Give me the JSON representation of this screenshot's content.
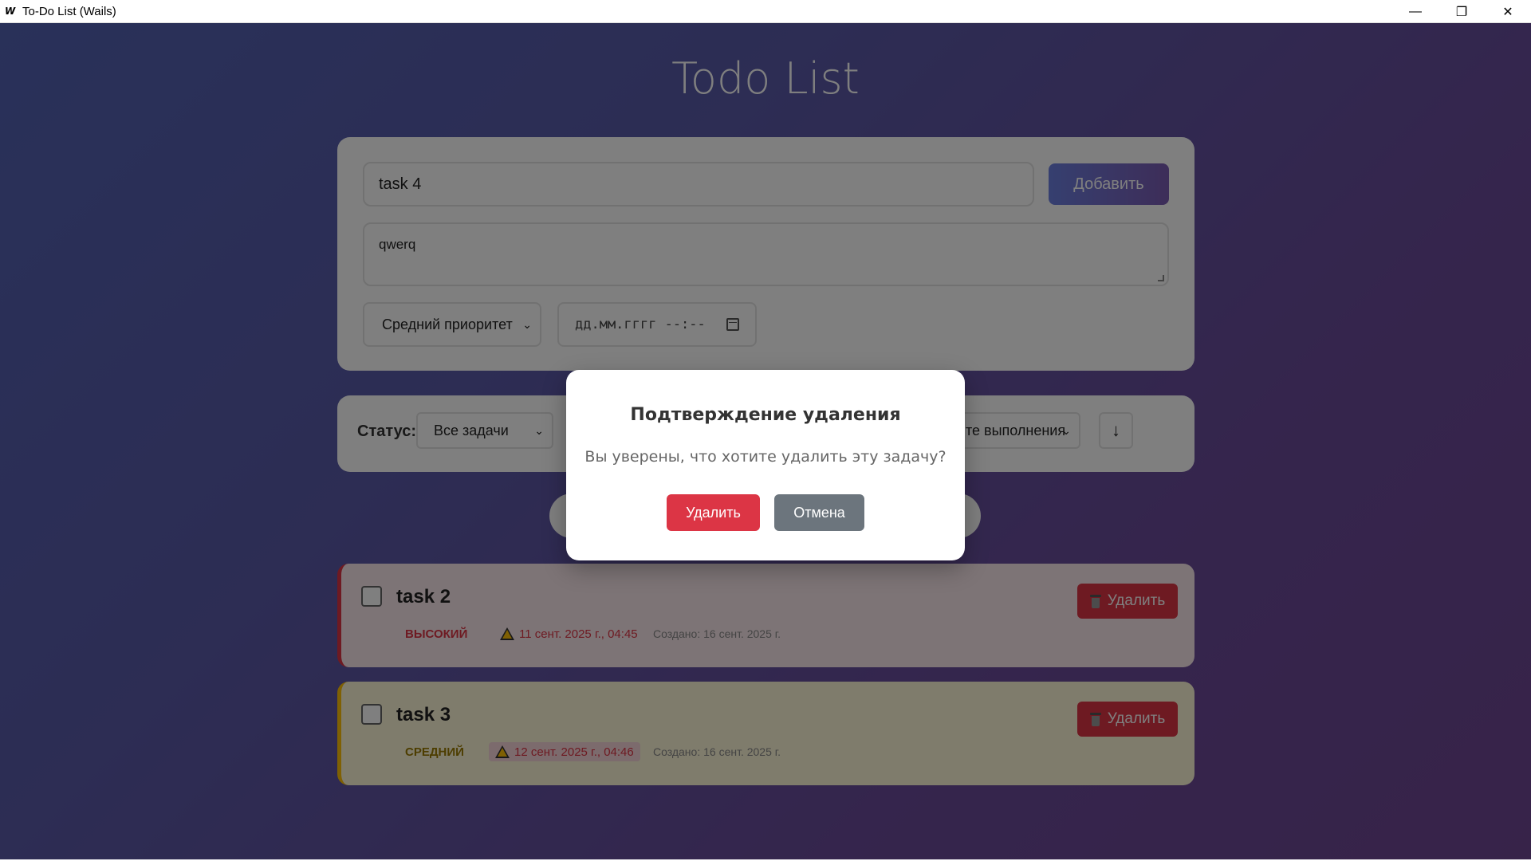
{
  "window": {
    "title": "To-Do List (Wails)",
    "logo_letter": "W",
    "minimize_glyph": "—",
    "maximize_glyph": "❐",
    "close_glyph": "✕"
  },
  "app": {
    "title": "Todo List"
  },
  "form": {
    "title_value": "task 4",
    "add_label": "Добавить",
    "description_value": "qwerq",
    "priority_selected": "Средний приоритет",
    "due_placeholder": "дд.мм.гггг --:--"
  },
  "filters": {
    "status_label": "Статус:",
    "status_selected": "Все задачи",
    "sort_selected_visible": "те выполнения",
    "sort_direction": "↓"
  },
  "tasks": [
    {
      "title": "task 2",
      "priority": "ВЫСОКИЙ",
      "due": "11 сент. 2025 г., 04:45",
      "created": "Создано: 16 сент. 2025 г.",
      "delete_label": "Удалить",
      "accent_color": "#dc3545"
    },
    {
      "title": "task 3",
      "priority": "СРЕДНИЙ",
      "due": "12 сент. 2025 г., 04:46",
      "created": "Создано: 16 сент. 2025 г.",
      "delete_label": "Удалить",
      "accent_color": "#ffc107"
    }
  ],
  "modal": {
    "title": "Подтверждение удаления",
    "message": "Вы уверены, что хотите удалить эту задачу?",
    "confirm_label": "Удалить",
    "cancel_label": "Отмена"
  },
  "icons": {
    "chevron": "⌄",
    "calendar": "calendar-icon",
    "warning": "warning-icon",
    "trash": "trash-icon"
  }
}
